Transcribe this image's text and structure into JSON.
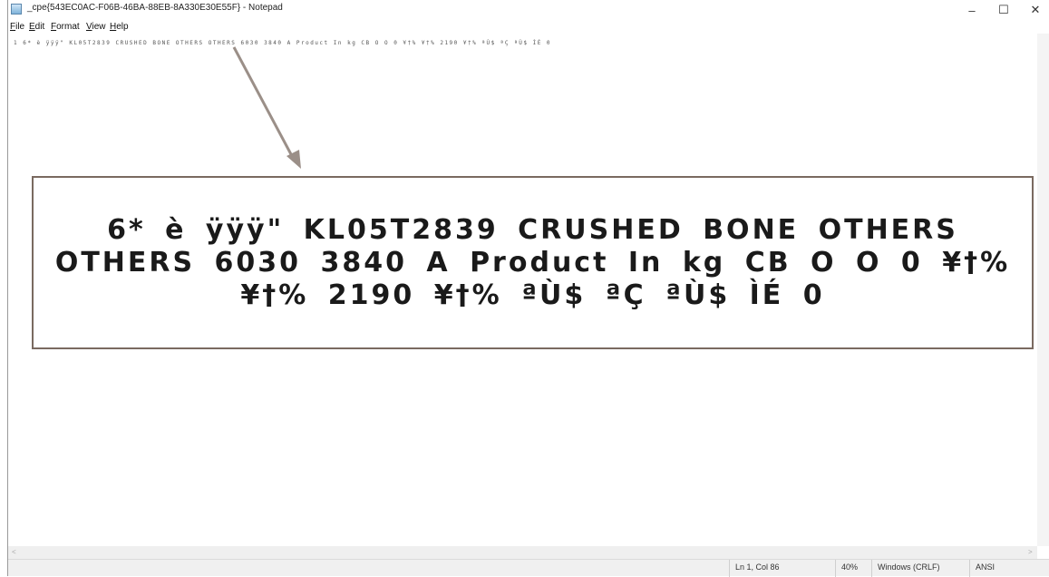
{
  "window": {
    "title": "_cpe{543EC0AC-F06B-46BA-88EB-8A330E30E55F} - Notepad",
    "controls": {
      "minimize": "–",
      "maximize": "☐",
      "close": "✕"
    }
  },
  "menu": {
    "file": "File",
    "edit": "Edit",
    "format": "Format",
    "view": "View",
    "help": "Help"
  },
  "editor": {
    "line1": "1  6*  è     ÿÿÿ\"  KL05T2839  CRUSHED  BONE  OTHERS  OTHERS  6030   3840   A  Product  In  kg    CB  O  O   0   ¥†%   ¥†%   2190  ¥†%   ªÙ$ ªÇ  ªÙ$ ÌÉ  0"
  },
  "callout": {
    "text": "6* è   ÿÿÿ\" KL05T2839 CRUSHED BONE OTHERS OTHERS 6030  3840  A Product In kg  CB O O  0  ¥†%  ¥†%  2190 ¥†%  ªÙ$ ªÇ ªÙ$ ÌÉ 0"
  },
  "status": {
    "position": "Ln 1, Col 86",
    "zoom": "40%",
    "line_endings": "Windows (CRLF)",
    "encoding": "ANSI"
  },
  "colors": {
    "arrow": "#9b8f88",
    "callout_border": "#7a6a60"
  }
}
